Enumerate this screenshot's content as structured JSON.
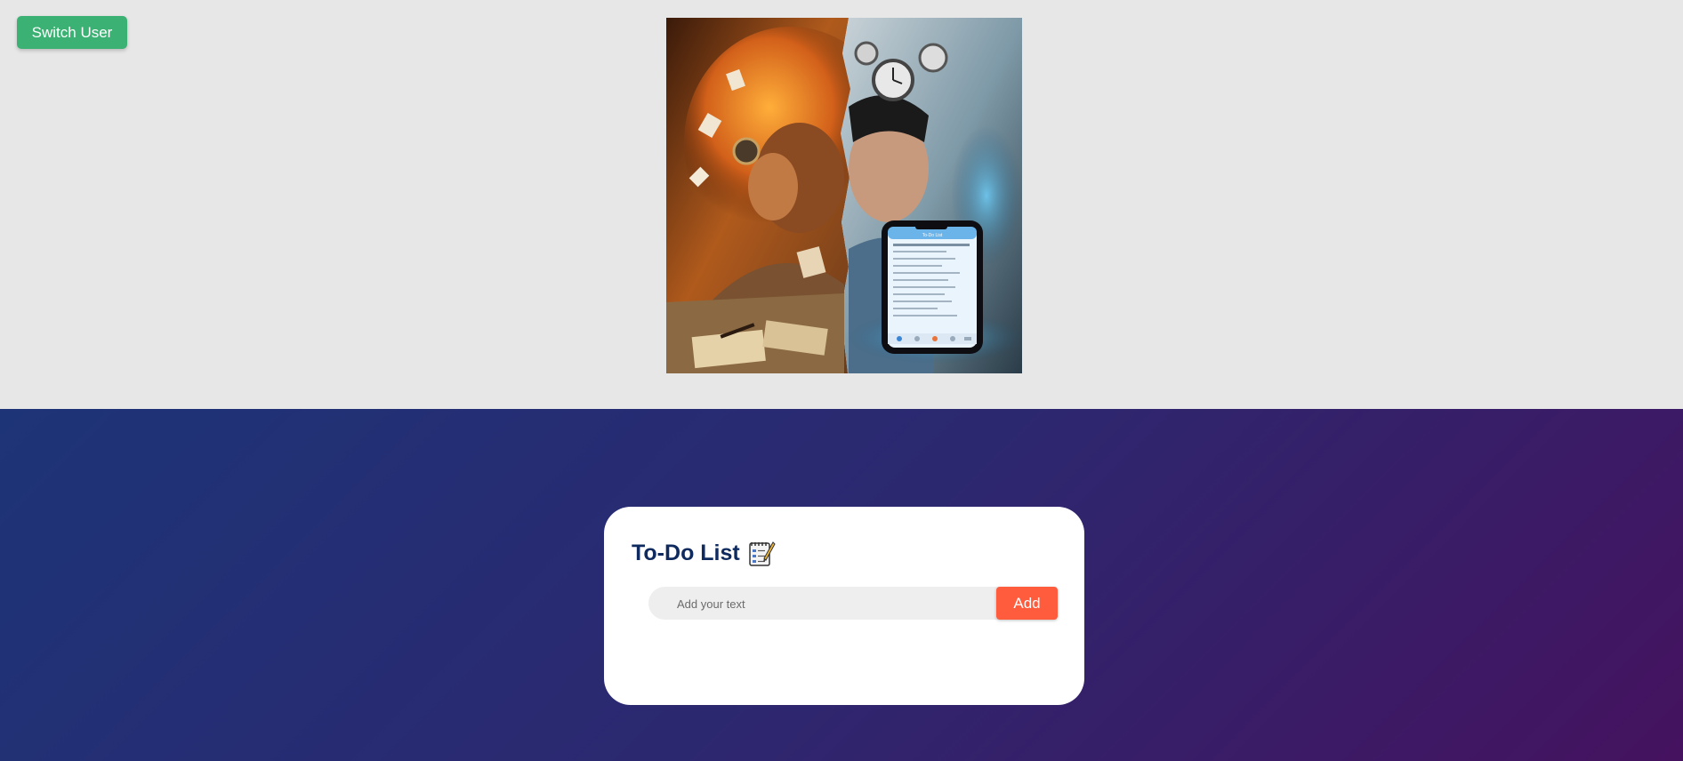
{
  "header": {
    "switch_user_label": "Switch User",
    "accent_color": "#3bb273"
  },
  "hero": {
    "icon": "stress-vs-organized-illustration",
    "phone_screen_title": "To-Do List"
  },
  "todo": {
    "title": "To-Do List",
    "title_icon": "notepad-pencil-icon",
    "input_placeholder": "Add your text",
    "input_value": "",
    "add_label": "Add",
    "add_color": "#ff5b3d",
    "title_color": "#0f2a5e",
    "items": []
  },
  "background": {
    "gradient_start": "#1d3477",
    "gradient_end": "#45125f",
    "top_color": "#e7e7e7"
  }
}
